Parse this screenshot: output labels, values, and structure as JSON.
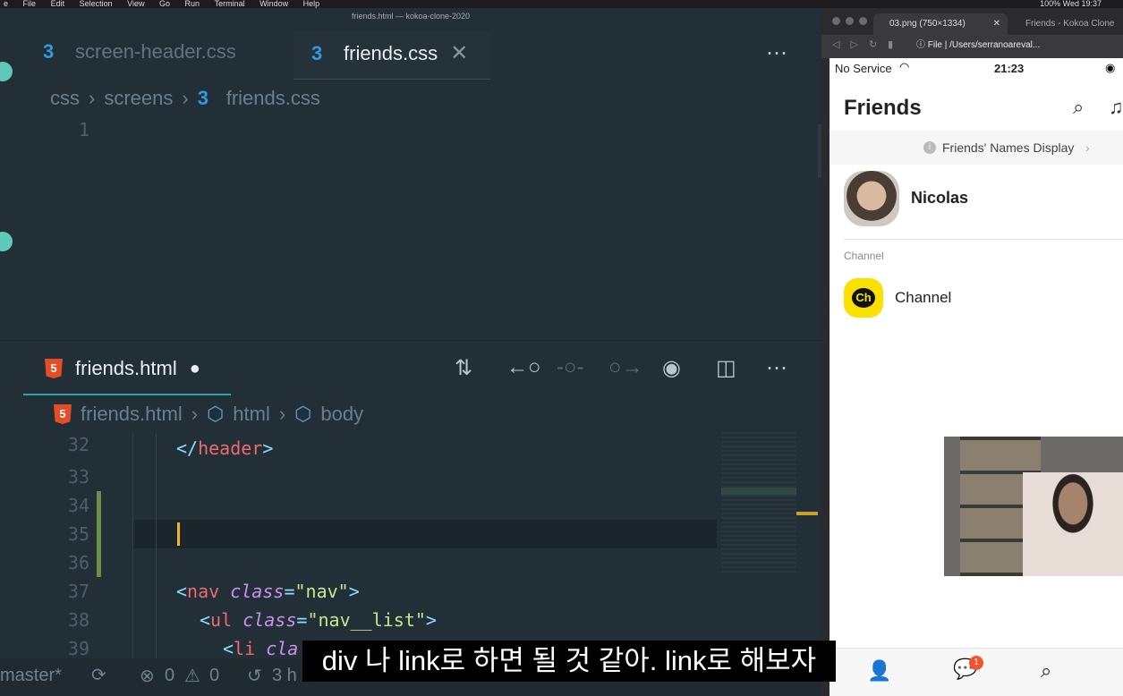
{
  "menubar": {
    "items": [
      "e",
      "File",
      "Edit",
      "Selection",
      "View",
      "Go",
      "Run",
      "Terminal",
      "Window",
      "Help"
    ],
    "right": "100%   Wed 19:37"
  },
  "editor": {
    "window_title": "friends.html — kokoa-clone-2020",
    "top_tabs": [
      {
        "label": "screen-header.css",
        "active": false
      },
      {
        "label": "friends.css",
        "active": true
      }
    ],
    "top_breadcrumb": [
      "css",
      "screens",
      "friends.css"
    ],
    "top_line_number": "1",
    "bottom_tab": {
      "label": "friends.html",
      "modified_dot": "●"
    },
    "bottom_breadcrumb": [
      "friends.html",
      "html",
      "body"
    ],
    "lines": [
      {
        "num": "32",
        "indent": 2,
        "html": "</header>"
      },
      {
        "num": "33",
        "indent": 0,
        "html": ""
      },
      {
        "num": "34",
        "indent": 0,
        "html": ""
      },
      {
        "num": "35",
        "indent": 0,
        "html": ""
      },
      {
        "num": "36",
        "indent": 0,
        "html": ""
      },
      {
        "num": "37",
        "indent": 2,
        "html": "<nav class=\"nav\">"
      },
      {
        "num": "38",
        "indent": 3,
        "html": "<ul class=\"nav__list\">"
      },
      {
        "num": "39",
        "indent": 4,
        "html": "<li cla"
      }
    ]
  },
  "statusbar": {
    "branch": "master*",
    "errors": "0",
    "warnings": "0",
    "time": "3 h"
  },
  "browser": {
    "tabs": [
      "03.png (750×1334)",
      "Friends - Kokoa Clone"
    ],
    "address_scheme": "File",
    "address": "/Users/serranoareval..."
  },
  "phone": {
    "carrier": "No Service",
    "time": "21:23",
    "title": "Friends",
    "banner": "Friends' Names Display",
    "profile_name": "Nicolas",
    "section_label": "Channel",
    "channel_name": "Channel",
    "channel_icon_text": "Ch",
    "chat_badge": "1"
  },
  "subtitle": "div 나 link로 하면 될 것 같아. link로 해보자"
}
